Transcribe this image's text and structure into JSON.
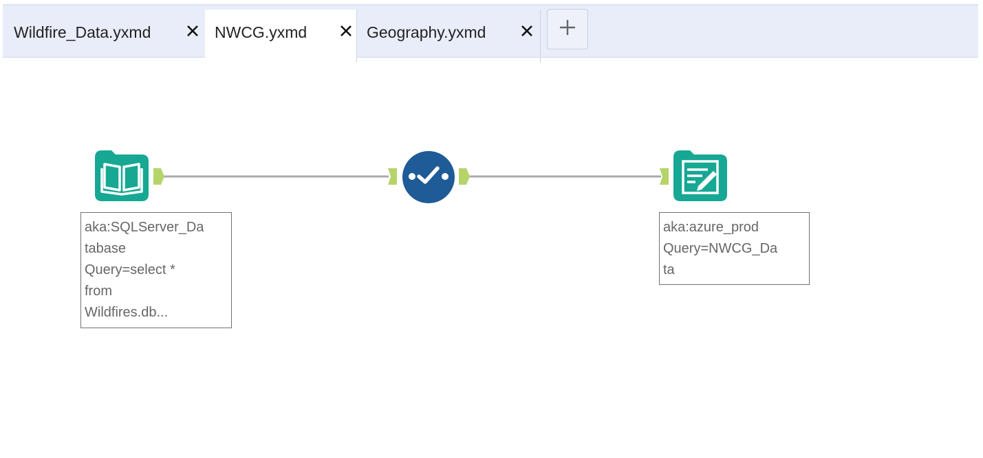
{
  "tabs": [
    {
      "label": "Wildfire_Data.yxmd",
      "active": false
    },
    {
      "label": "NWCG.yxmd",
      "active": true
    },
    {
      "label": "Geography.yxmd",
      "active": false
    }
  ],
  "add_tab_icon": "plus-icon",
  "canvas": {
    "input_tool": {
      "icon": "book-icon",
      "color": "#17a894",
      "annotation_lines": [
        "aka:SQLServer_Da",
        "tabase",
        "Query=select *",
        "from",
        "Wildfires.db..."
      ]
    },
    "middle_tool": {
      "icon": "check-icon",
      "color": "#1f5b96"
    },
    "output_tool": {
      "icon": "edit-document-icon",
      "color": "#17a894",
      "annotation_lines": [
        "aka:azure_prod",
        "Query=NWCG_Da",
        "ta"
      ]
    },
    "connector_color": "#a9a9a9",
    "anchor_color": "#b5d46a"
  }
}
